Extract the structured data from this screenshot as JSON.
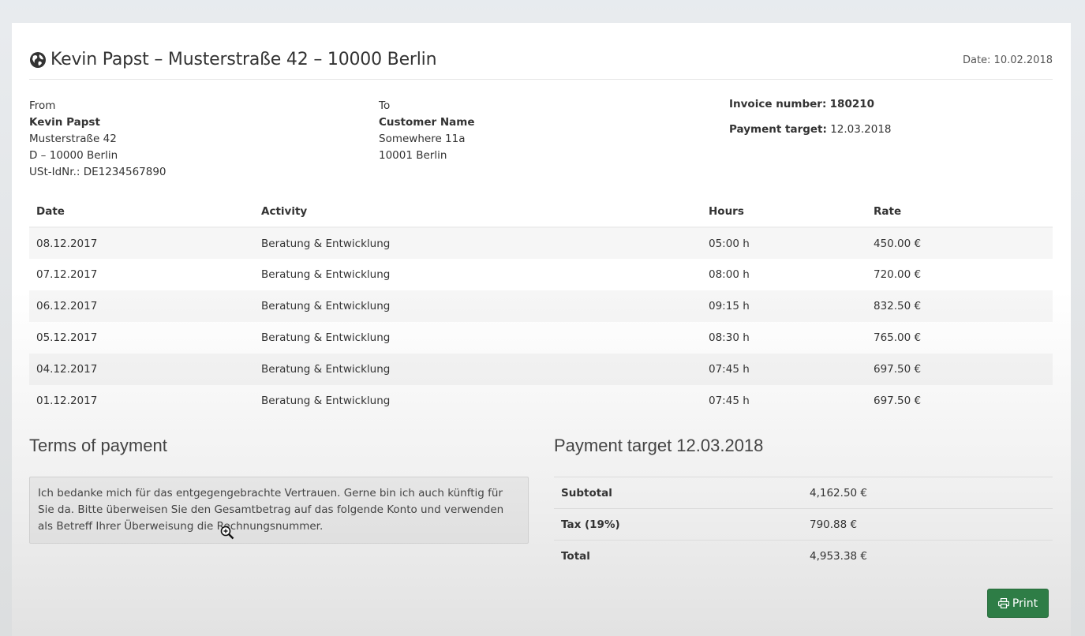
{
  "header": {
    "title": "Kevin Papst – Musterstraße 42 – 10000 Berlin",
    "date": "Date: 10.02.2018",
    "icon": "globe-icon"
  },
  "from": {
    "label": "From",
    "name": "Kevin Papst",
    "street": "Musterstraße 42",
    "city": "D – 10000 Berlin",
    "vat": "USt-IdNr.: DE1234567890"
  },
  "to": {
    "label": "To",
    "name": "Customer Name",
    "street": "Somewhere 11a",
    "city": "10001 Berlin"
  },
  "invoice": {
    "number_label": "Invoice number:",
    "number": "180210",
    "target_label": "Payment target:",
    "target": "12.03.2018"
  },
  "items": {
    "headers": [
      "Date",
      "Activity",
      "Hours",
      "Rate"
    ],
    "rows": [
      [
        "08.12.2017",
        "Beratung & Entwicklung",
        "05:00 h",
        "450.00 €"
      ],
      [
        "07.12.2017",
        "Beratung & Entwicklung",
        "08:00 h",
        "720.00 €"
      ],
      [
        "06.12.2017",
        "Beratung & Entwicklung",
        "09:15 h",
        "832.50 €"
      ],
      [
        "05.12.2017",
        "Beratung & Entwicklung",
        "08:30 h",
        "765.00 €"
      ],
      [
        "04.12.2017",
        "Beratung & Entwicklung",
        "07:45 h",
        "697.50 €"
      ],
      [
        "01.12.2017",
        "Beratung & Entwicklung",
        "07:45 h",
        "697.50 €"
      ]
    ]
  },
  "terms": {
    "title": "Terms of payment",
    "text": "Ich bedanke mich für das entgegengebrachte Vertrauen. Gerne bin ich auch künftig für Sie da. Bitte überweisen Sie den Gesamtbetrag auf das folgende Konto und verwenden als Betreff Ihrer Überweisung die Rechnungsnummer."
  },
  "summary": {
    "title": "Payment target 12.03.2018",
    "subtotal_label": "Subtotal",
    "subtotal": "4,162.50 €",
    "tax_label": "Tax (19%)",
    "tax": "790.88 €",
    "total_label": "Total",
    "total": "4,953.38 €"
  },
  "actions": {
    "print_label": "Print",
    "print_icon": "printer-icon",
    "print_color": "#2e7d46"
  }
}
